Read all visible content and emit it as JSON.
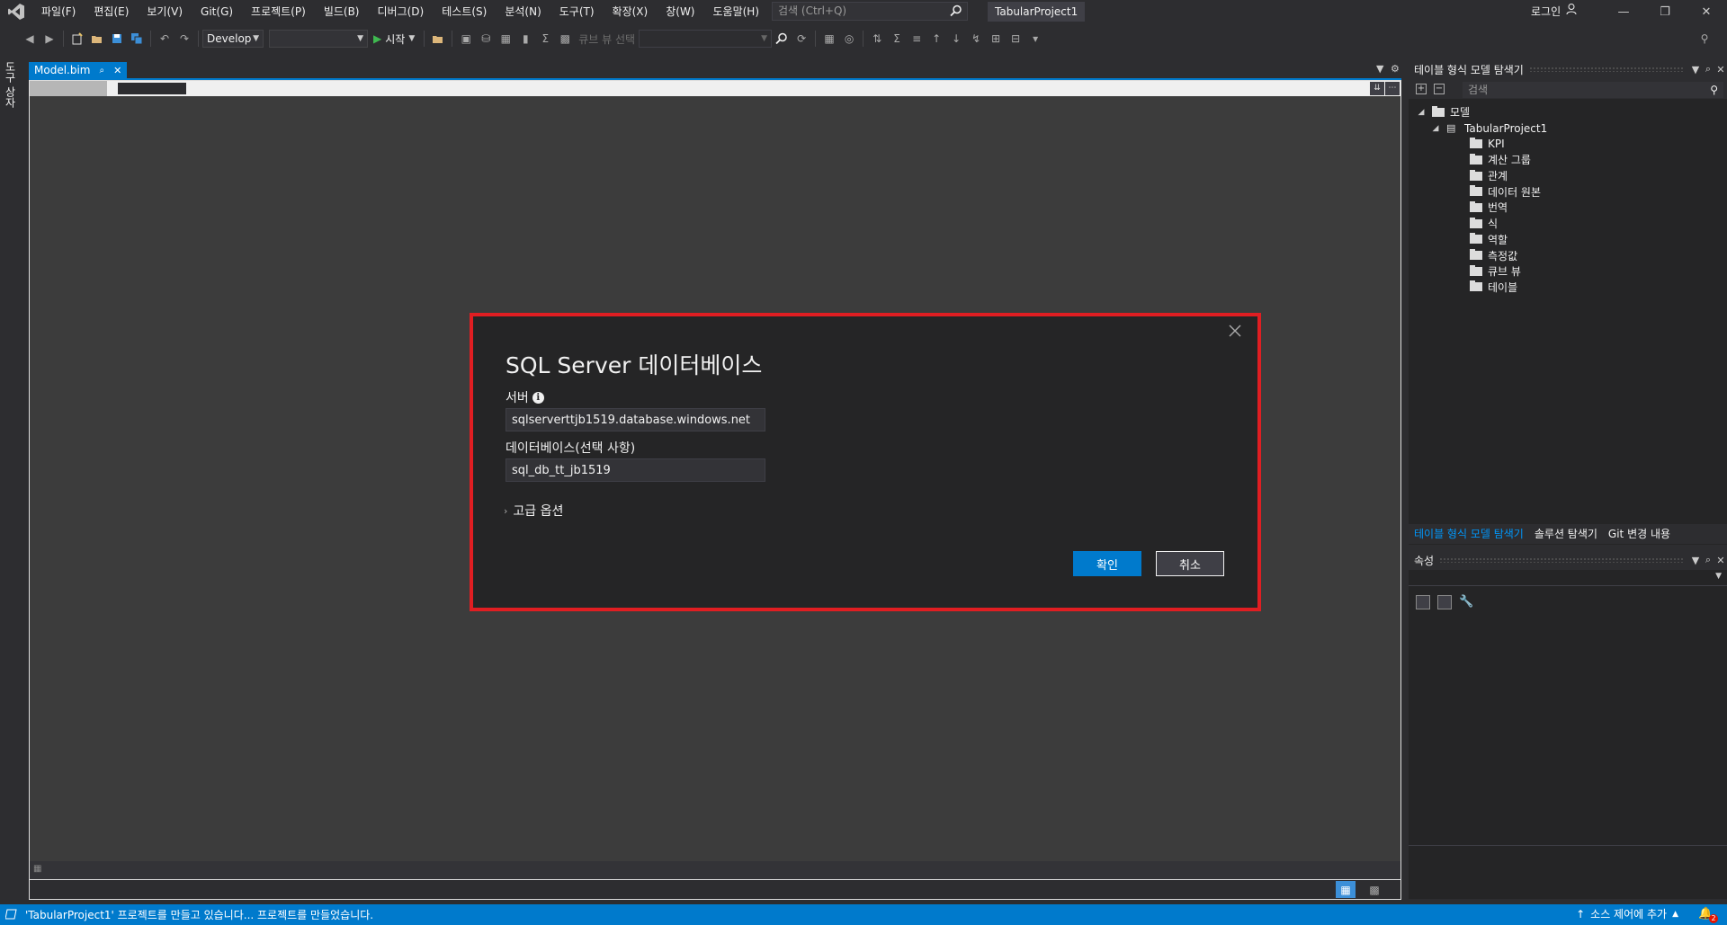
{
  "menu": {
    "items": [
      "파일(F)",
      "편집(E)",
      "보기(V)",
      "Git(G)",
      "프로젝트(P)",
      "빌드(B)",
      "디버그(D)",
      "테스트(S)",
      "분석(N)",
      "도구(T)",
      "확장(X)",
      "창(W)",
      "도움말(H)"
    ]
  },
  "search": {
    "placeholder": "검색 (Ctrl+Q)"
  },
  "window": {
    "title": "TabularProject1",
    "login": "로그인"
  },
  "toolbar": {
    "config": "Develop",
    "platform": "",
    "start_label": "시작",
    "cube_view_label": "큐브 뷰 선택"
  },
  "left_strip": {
    "label": "도구 상자"
  },
  "doc": {
    "tab_label": "Model.bim"
  },
  "dialog": {
    "title": "SQL Server 데이터베이스",
    "server_label": "서버",
    "server_value": "sqlserverttjb1519.database.windows.net",
    "database_label": "데이터베이스(선택 사항)",
    "database_value": "sql_db_tt_jb1519",
    "advanced_label": "고급 옵션",
    "ok_label": "확인",
    "cancel_label": "취소"
  },
  "explorer": {
    "title": "테이블 형식 모델 탐색기",
    "search_placeholder": "검색",
    "root": "모델",
    "project": "TabularProject1",
    "items": [
      "KPI",
      "계산 그룹",
      "관계",
      "데이터 원본",
      "번역",
      "식",
      "역할",
      "측정값",
      "큐브 뷰",
      "테이블"
    ]
  },
  "panel_tabs": [
    "테이블 형식 모델 탐색기",
    "솔루션 탐색기",
    "Git 변경 내용"
  ],
  "properties": {
    "title": "속성"
  },
  "status": {
    "message": "'TabularProject1' 프로젝트를 만들고 있습니다... 프로젝트를 만들었습니다.",
    "source_control": "소스 제어에 추가",
    "notifications": "2"
  },
  "colors": {
    "accent": "#007acc",
    "highlight_border": "#e01e22"
  }
}
